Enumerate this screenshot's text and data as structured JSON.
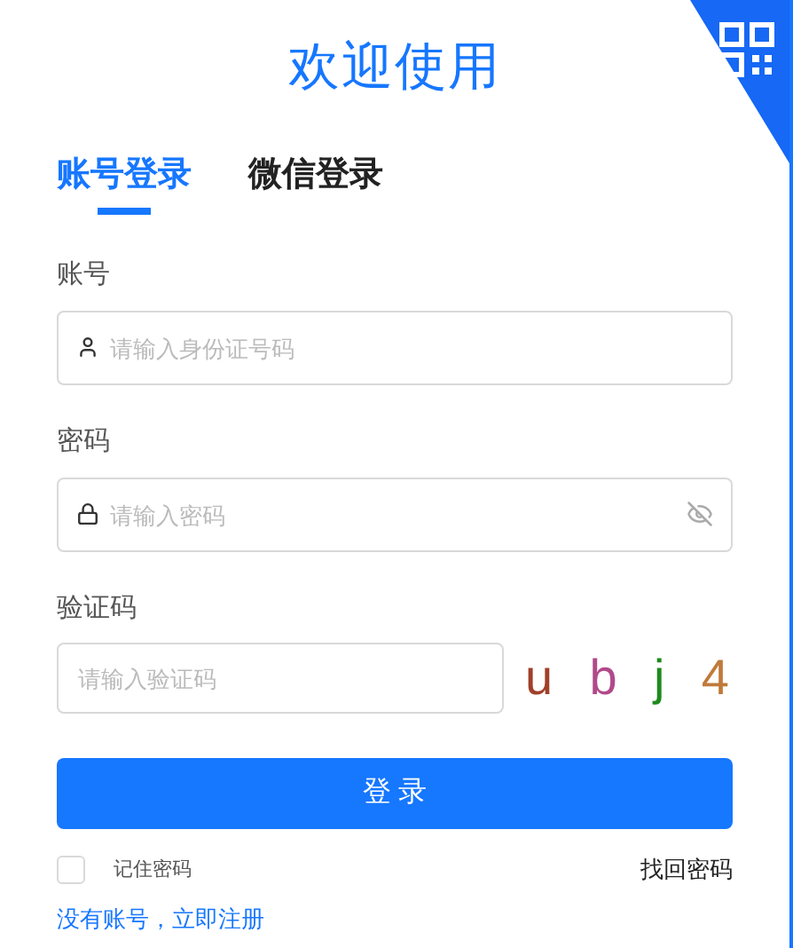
{
  "title": "欢迎使用",
  "tabs": [
    {
      "label": "账号登录",
      "selected": true
    },
    {
      "label": "微信登录",
      "selected": false
    }
  ],
  "fields": [
    {
      "label": "账号",
      "placeholder": "请输入身份证号码",
      "kind": "account"
    },
    {
      "label": "密码",
      "placeholder": "请输入密码",
      "kind": "password"
    },
    {
      "label": "验证码",
      "placeholder": "请输入验证码",
      "kind": "captcha"
    }
  ],
  "captcha": [
    {
      "text": "u",
      "color": "#a0402a"
    },
    {
      "text": "b",
      "color": "#b04a8a"
    },
    {
      "text": "j",
      "color": "#1e8a1e"
    },
    {
      "text": "4",
      "color": "#c07a3a"
    }
  ],
  "login_button": "登 录",
  "remember": {
    "label": "记住密码",
    "checked": false
  },
  "forgot_link": "找回密码",
  "register_link": "没有账号，立即注册"
}
